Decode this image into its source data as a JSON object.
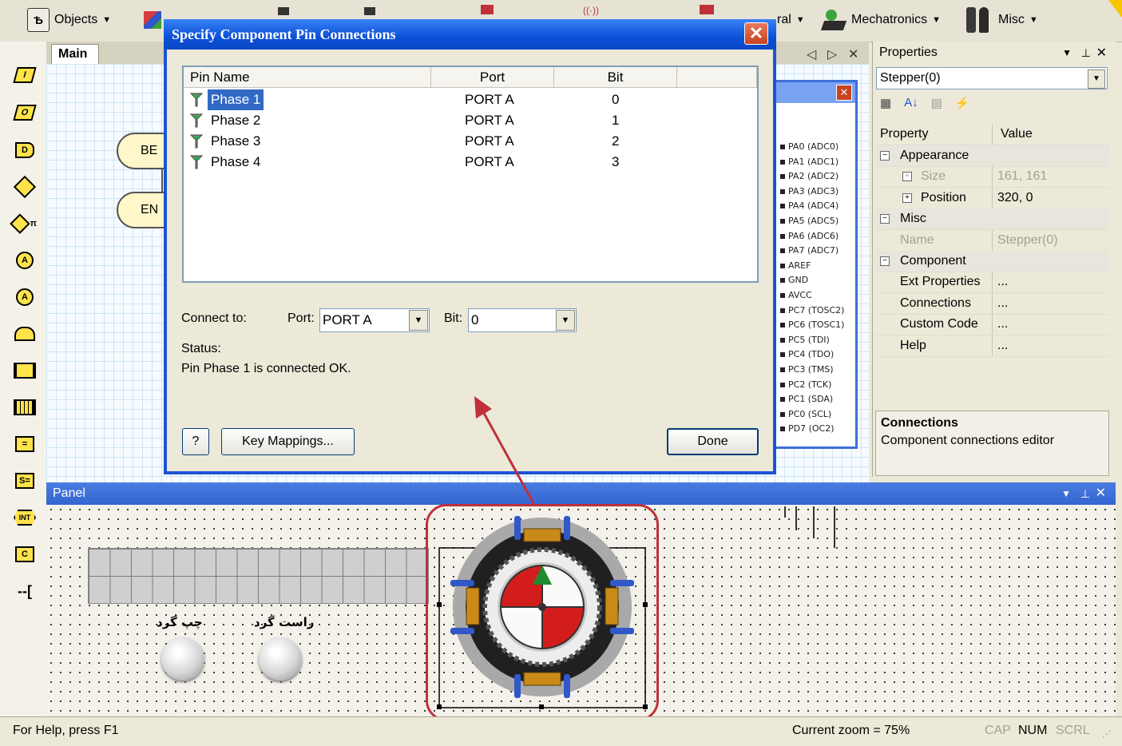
{
  "toolbar": {
    "objects_label": "Objects",
    "peripheral_label_partial": "ral",
    "mechatronics_label": "Mechatronics",
    "misc_label": "Misc"
  },
  "doc": {
    "main_tab": "Main",
    "begin_partial": "BE",
    "end_partial": "EN",
    "nav_prev": "◁",
    "nav_next": "▷",
    "nav_close": "✕"
  },
  "pin_window": {
    "pins": [
      "PA0 (ADC0)",
      "PA1 (ADC1)",
      "PA2 (ADC2)",
      "PA3 (ADC3)",
      "PA4 (ADC4)",
      "PA5 (ADC5)",
      "PA6 (ADC6)",
      "PA7 (ADC7)",
      "AREF",
      "GND",
      "AVCC",
      "PC7 (TOSC2)",
      "PC6 (TOSC1)",
      "PC5 (TDI)",
      "PC4 (TDO)",
      "PC3 (TMS)",
      "PC2 (TCK)",
      "PC1 (SDA)",
      "PC0 (SCL)",
      "PD7 (OC2)"
    ]
  },
  "properties": {
    "title": "Properties",
    "selected_object": "Stepper(0)",
    "col_property": "Property",
    "col_value": "Value",
    "rows": [
      {
        "name": "Appearance",
        "value": "",
        "category": true
      },
      {
        "name": "Size",
        "value": "161, 161",
        "disabled": true
      },
      {
        "name": "Position",
        "value": "320, 0"
      },
      {
        "name": "Misc",
        "value": "",
        "category": true
      },
      {
        "name": "Name",
        "value": "Stepper(0)",
        "disabled": true
      },
      {
        "name": "Component",
        "value": "",
        "category": true
      },
      {
        "name": "Ext Properties",
        "value": "..."
      },
      {
        "name": "Connections",
        "value": "..."
      },
      {
        "name": "Custom Code",
        "value": "..."
      },
      {
        "name": "Help",
        "value": "..."
      }
    ],
    "desc_title": "Connections",
    "desc_text": "Component connections editor"
  },
  "panel": {
    "title": "Panel",
    "left_button_label": "چپ گرد",
    "right_button_label": "راست گرد"
  },
  "dialog": {
    "title": "Specify Component Pin Connections",
    "close_label": "✕",
    "columns": [
      "Pin Name",
      "Port",
      "Bit"
    ],
    "rows": [
      {
        "pin": "Phase 1",
        "port": "PORT A",
        "bit": "0"
      },
      {
        "pin": "Phase 2",
        "port": "PORT A",
        "bit": "1"
      },
      {
        "pin": "Phase 3",
        "port": "PORT A",
        "bit": "2"
      },
      {
        "pin": "Phase 4",
        "port": "PORT A",
        "bit": "3"
      }
    ],
    "connect_to_label": "Connect to:",
    "port_label": "Port:",
    "port_value": "PORT A",
    "bit_label": "Bit:",
    "bit_value": "0",
    "status_label": "Status:",
    "status_text": "Pin Phase 1 is connected OK.",
    "help_button": "?",
    "key_mappings_button": "Key Mappings...",
    "done_button": "Done"
  },
  "statusbar": {
    "help_text": "For Help, press F1",
    "zoom_text": "Current zoom = 75%",
    "cap": "CAP",
    "num": "NUM",
    "scrl": "SCRL"
  },
  "colors": {
    "dialog_title": "#0b50d8",
    "selection": "#316ac5",
    "highlight_frame": "#c0303a",
    "arrow": "#c0303a"
  }
}
